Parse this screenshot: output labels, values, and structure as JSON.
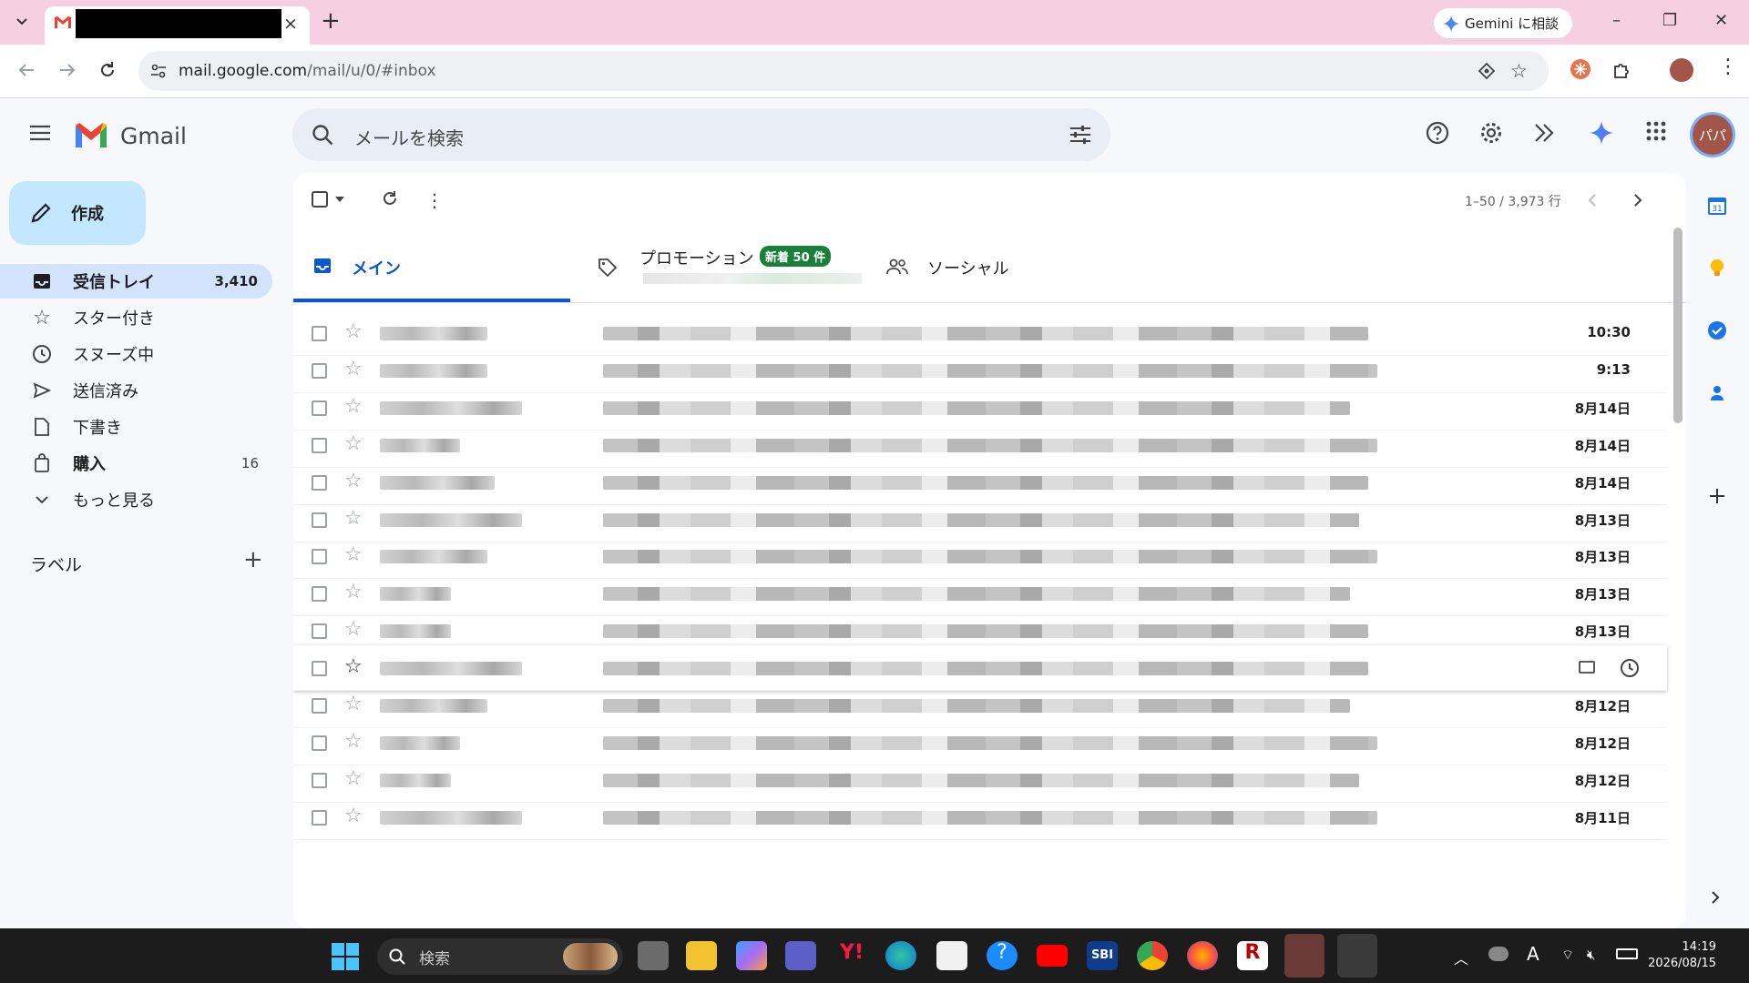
{
  "browser": {
    "tab": {
      "close_glyph": "×"
    },
    "new_tab_glyph": "+",
    "gemini_button": "Gemini に相談",
    "url_host": "mail.google.com",
    "url_path": "/mail/u/0/#inbox",
    "window_controls": [
      "–",
      "❐",
      "✕"
    ]
  },
  "gmail": {
    "logo_text": "Gmail",
    "search_placeholder": "メールを検索",
    "avatar_text": "パパ",
    "compose_label": "作成",
    "nav": [
      {
        "label": "受信トレイ",
        "count": "3,410",
        "icon": "inbox-icon"
      },
      {
        "label": "スター付き",
        "count": "",
        "icon": "star-icon"
      },
      {
        "label": "スヌーズ中",
        "count": "",
        "icon": "clock-icon"
      },
      {
        "label": "送信済み",
        "count": "",
        "icon": "send-icon"
      },
      {
        "label": "下書き",
        "count": "",
        "icon": "draft-icon"
      },
      {
        "label": "購入",
        "count": "16",
        "icon": "shopping-bag-icon"
      },
      {
        "label": "もっと見る",
        "count": "",
        "icon": "chevron-down-icon"
      }
    ],
    "labels_title": "ラベル",
    "labels_add": "+",
    "pager": "1–50 / 3,973 行",
    "tabs": {
      "main": "メイン",
      "promotions": "プロモーション",
      "promotions_badge": "新着 50 件",
      "social": "ソーシャル"
    },
    "emails": [
      {
        "date": "10:30",
        "star": "☆"
      },
      {
        "date": "9:13",
        "star": "☆"
      },
      {
        "date": "8月14日",
        "star": "☆"
      },
      {
        "date": "8月14日",
        "star": "☆"
      },
      {
        "date": "8月14日",
        "star": "☆"
      },
      {
        "date": "8月13日",
        "star": "☆"
      },
      {
        "date": "8月13日",
        "star": "☆"
      },
      {
        "date": "8月13日",
        "star": "☆"
      },
      {
        "date": "8月13日",
        "star": "☆"
      },
      {
        "date": "",
        "star": "☆"
      },
      {
        "date": "8月12日",
        "star": "☆"
      },
      {
        "date": "8月12日",
        "star": "☆"
      },
      {
        "date": "8月12日",
        "star": "☆"
      },
      {
        "date": "8月11日",
        "star": "☆"
      }
    ]
  },
  "taskbar": {
    "search_placeholder": "検索",
    "time": "14:19",
    "date": "2026/08/15",
    "ime": "A"
  }
}
